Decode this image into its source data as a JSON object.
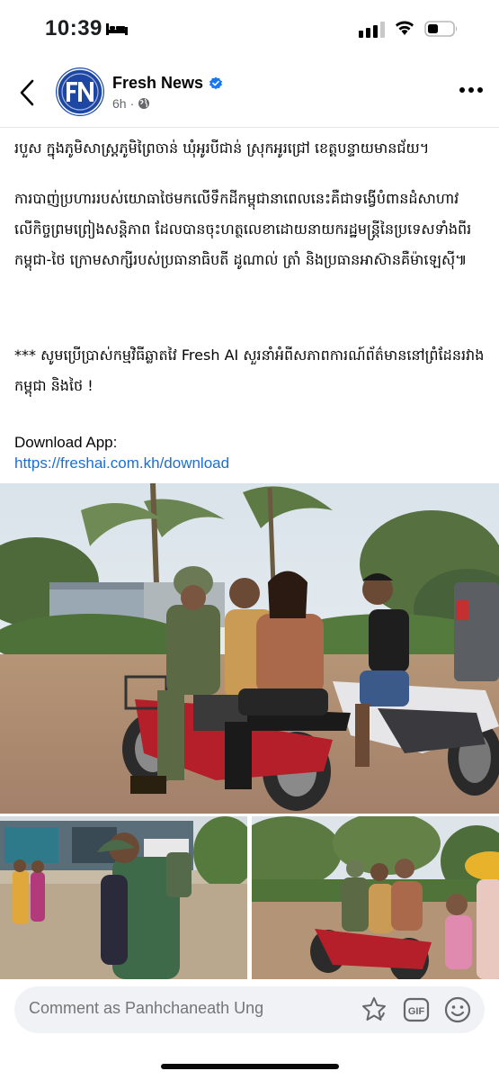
{
  "status_bar": {
    "time": "10:39",
    "icons": [
      "bed-icon",
      "cellular-signal-icon",
      "wifi-icon",
      "battery-icon"
    ]
  },
  "header": {
    "page_name": "Fresh News",
    "avatar_text": "FN",
    "time_ago": "6h",
    "separator": "·",
    "verified_color": "#1877f2",
    "icons": [
      "back-arrow-icon",
      "verified-badge-icon",
      "globe-icon",
      "more-options-icon"
    ]
  },
  "post": {
    "paragraph_top": "របួស ក្នុងភូមិសាស្ត្រភូមិព្រៃចាន់ ឃុំអូរបីជាន់ ស្រុកអូរជ្រៅ ខេត្តបន្ទាយមានជ័យ។",
    "paragraph_1": "ការបាញ់ប្រហាររបស់យោធាថៃមកលើទឹកដីកម្ពុជានាពេលនេះគឺជាទង្វើបំពានដំសាហាវលើកិច្ចព្រមព្រៀងសន្តិភាព ដែលបានចុះហត្ថលេខាដោយនាយករដ្ឋមន្ត្រីនៃប្រទេសទាំងពីរ កម្ពុជា-ថៃ ក្រោមសាក្សីរបស់ប្រធានាធិបតី ដូណាល់ ត្រាំ និងប្រធានអាស៊ានគឺម៉ាឡេស៊ី៕",
    "paragraph_2": "*** សូមប្រើប្រាស់កម្មវិធីឆ្លាតវៃ Fresh AI សួរនាំអំពីសភាពការណ៍ព័ត៌មាននៅព្រំដែនរវាងកម្ពុជា និងថៃ !",
    "download_label": "Download App:",
    "download_link": "https://freshai.com.kh/download"
  },
  "photos": [
    {
      "name": "photo-soldier-motorbike"
    },
    {
      "name": "photo-soldier-evacuating"
    },
    {
      "name": "photo-soldier-family"
    }
  ],
  "comment_bar": {
    "placeholder": "Comment as Panhchaneath Ung",
    "icons": [
      "sticker-icon",
      "gif-icon",
      "emoji-icon"
    ]
  }
}
